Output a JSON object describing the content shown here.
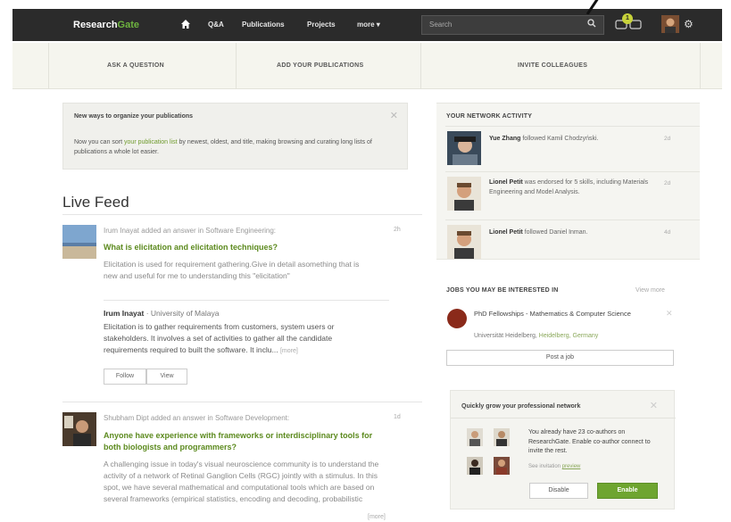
{
  "nav": {
    "brand_a": "Research",
    "brand_b": "Gate",
    "items": [
      "Q&A",
      "Publications",
      "Projects",
      "more ▾"
    ],
    "search_placeholder": "Search",
    "notification_count": "1"
  },
  "actions": {
    "ask": "ASK A QUESTION",
    "add": "ADD YOUR PUBLICATIONS",
    "invite": "INVITE COLLEAGUES"
  },
  "tip": {
    "title": "New ways to organize your publications",
    "body_pre": "Now you can sort ",
    "body_link": "your publication list",
    "body_post": " by newest, oldest, and title, making browsing and curating long lists of publications a whole lot easier."
  },
  "feed": {
    "title": "Live Feed",
    "items": [
      {
        "meta": "Irum Inayat added an answer in Software Engineering:",
        "time": "2h",
        "question": "What is elicitation and elicitation techniques?",
        "excerpt": "Elicitation is used for requirement gathering.Give in detail asomething that is new and useful for me to understanding this \"elicitation\"",
        "answer_author": "Irum Inayat",
        "answer_affil": " · University of Malaya",
        "answer_text": "Elicitation is to gather requirements from customers, system users or stakeholders. It involves a set of activities to gather all the candidate requirements required to built the software. It inclu...",
        "more": "[more]",
        "follow": "Follow",
        "view": "View"
      },
      {
        "meta": "Shubham Dipt added an answer in Software Development:",
        "time": "1d",
        "question": "Anyone have experience with frameworks or interdisciplinary tools for both biologists and programmers?",
        "excerpt": "A challenging issue in today's visual neuroscience community is to understand the activity of a network of Retinal Ganglion Cells (RGC) jointly with a stimulus. In this spot, we have several mathematical and computational tools which are based on several frameworks (empirical statistics, encoding and decoding, probabilistic",
        "more": "[more]"
      }
    ]
  },
  "network": {
    "title": "YOUR NETWORK ACTIVITY",
    "items": [
      {
        "name": "Yue Zhang",
        "text": " followed Kamil Chodzyński.",
        "time": "2d"
      },
      {
        "name": "Lionel Petit",
        "text": " was endorsed for 5 skills, including Materials Engineering and Model Analysis.",
        "time": "2d"
      },
      {
        "name": "Lionel Petit",
        "text": " followed Daniel Inman.",
        "time": "4d"
      }
    ]
  },
  "jobs": {
    "title": "JOBS YOU MAY BE INTERESTED IN",
    "view_more": "View more",
    "job_title": "PhD Fellowships - Mathematics & Computer Science",
    "job_org": "Universität Heidelberg, ",
    "job_place": "Heidelberg, Germany",
    "post": "Post a job"
  },
  "grow": {
    "title": "Quickly grow your professional network",
    "text": "You already have 23 co-authors on ResearchGate. Enable co-author connect to invite the rest.",
    "link_pre": "See invitation ",
    "link": "preview",
    "disable": "Disable",
    "enable": "Enable"
  },
  "colors": {
    "accent_green": "#6ea530",
    "link_green": "#5c8a1e",
    "topbar": "#2b2b2b"
  }
}
